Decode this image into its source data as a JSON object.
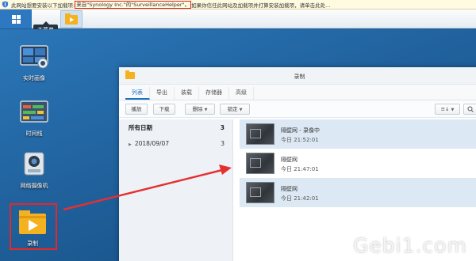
{
  "infobar": {
    "text_before": "此网站想要安装以下加载项: ",
    "highlight": "来自\"Synology Inc.\"的\"SurveillanceHelper\"。",
    "text_after": "如果你信任此网站及加载项并打算安装加载项，请单击此处..."
  },
  "taskbar": {
    "tooltip": "主菜单"
  },
  "desktop": {
    "icons": [
      {
        "label": "实时画像"
      },
      {
        "label": "时间线"
      },
      {
        "label": "网络摄像机"
      },
      {
        "label": "录制"
      }
    ]
  },
  "window": {
    "title": "录制",
    "tabs": [
      "列表",
      "导出",
      "装载",
      "存储器",
      "高级"
    ],
    "toolbar": {
      "play": "播放",
      "download": "下载",
      "delete": "删除",
      "lock": "锁定",
      "sort_icon": "sort-list-icon"
    },
    "sidebar": {
      "all_dates": {
        "label": "所有日期",
        "count": "3"
      },
      "dates": [
        {
          "label": "2018/09/07",
          "count": "3"
        }
      ]
    },
    "recordings": [
      {
        "name": "隔壁网 - 录像中",
        "time": "今日 21:52:01"
      },
      {
        "name": "隔壁网",
        "time": "今日 21:47:01"
      },
      {
        "name": "隔壁网",
        "time": "今日 21:42:01"
      }
    ]
  },
  "watermark": "Gebi1.com",
  "colors": {
    "desktop": "#1e5d97",
    "highlight_red": "#e02020",
    "accent": "#1f70c0",
    "folder": "#f4b221"
  }
}
